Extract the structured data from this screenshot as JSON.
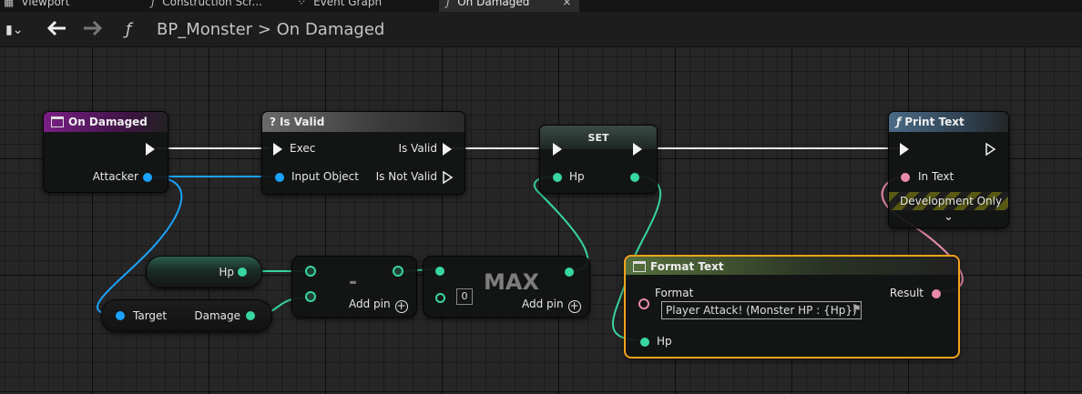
{
  "tabs": [
    {
      "label": "Viewport",
      "icon": "viewport-icon"
    },
    {
      "label": "Construction Scr...",
      "icon": "function-icon"
    },
    {
      "label": "Event Graph",
      "icon": "event-graph-icon"
    },
    {
      "label": "On Damaged",
      "icon": "function-icon",
      "close": "×"
    }
  ],
  "toolbar": {
    "back_icon": "back-arrow-icon",
    "forward_icon": "forward-arrow-icon",
    "function_glyph": "ƒ",
    "blueprint": "BP_Monster",
    "separator": ">",
    "function_name": "On Damaged"
  },
  "nodes": {
    "on_damaged": {
      "title": "On Damaged",
      "pin_attacker": "Attacker"
    },
    "is_valid": {
      "title": "Is Valid",
      "pin_exec": "Exec",
      "pin_input": "Input Object",
      "pin_is_valid": "Is Valid",
      "pin_not_valid": "Is Not Valid"
    },
    "set": {
      "title": "SET",
      "pin_hp": "Hp"
    },
    "print_text": {
      "title": "Print Text",
      "pin_in": "In Text",
      "dev_only": "Development Only"
    },
    "get_hp": {
      "label": "Hp"
    },
    "get_target": {
      "pin_target": "Target",
      "pin_damage": "Damage"
    },
    "subtract": {
      "symbol": "-",
      "add_pin": "Add pin"
    },
    "max": {
      "symbol": "MAX",
      "default_value": "0",
      "add_pin": "Add pin"
    },
    "format_text": {
      "title": "Format Text",
      "pin_format": "Format",
      "format_value": "Player Attack! (Monster HP : {Hp})",
      "pin_hp": "Hp",
      "pin_result": "Result"
    }
  },
  "colors": {
    "object_pin": "#1aa3ff",
    "float_pin": "#38d6a0",
    "text_pin": "#e98aac",
    "exec_pin": "#f2f2f2",
    "event_header": "#7a1f86",
    "pure_header": "#5a5a5a",
    "function_header": "#4a6a86",
    "selected_outline": "#f5a21b"
  }
}
